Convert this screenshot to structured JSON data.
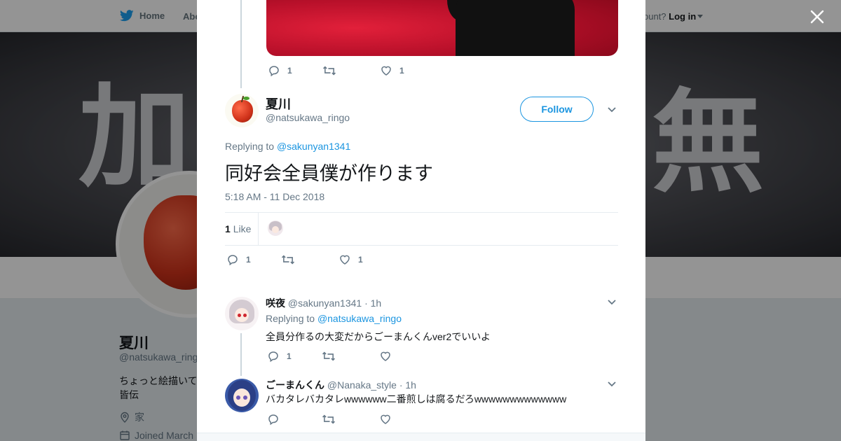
{
  "topbar": {
    "home_label": "Home",
    "about_label": "Abo",
    "account_prompt": "ccount?",
    "login_label": "Log in"
  },
  "banner": {
    "left_text": "加",
    "right_text": "無"
  },
  "profile": {
    "name": "夏川",
    "handle": "@natsukawa_ring",
    "bio_line1": "ちょっと絵描いて",
    "bio_line2": "皆伝",
    "location": "家",
    "joined": "Joined March"
  },
  "previous_tweet": {
    "reply_count": "1",
    "like_count": "1"
  },
  "main_tweet": {
    "name": "夏川",
    "handle": "@natsukawa_ringo",
    "follow_label": "Follow",
    "replying_prefix": "Replying to",
    "replying_to": "@sakunyan1341",
    "text": "同好会全員僕が作ります",
    "timestamp": "5:18 AM - 11 Dec 2018",
    "like_stat_count": "1",
    "like_stat_label": "Like",
    "reply_count": "1",
    "like_count": "1"
  },
  "replies": [
    {
      "name": "咲夜",
      "handle": "@sakunyan1341",
      "time": "· 1h",
      "replying_prefix": "Replying to",
      "replying_to": "@natsukawa_ringo",
      "text": "全員分作るの大変だからごーまんくんver2でいいよ",
      "reply_count": "1"
    },
    {
      "name": "ごーまんくん",
      "handle": "@Nanaka_style",
      "time": "· 1h",
      "text": "バカタレバカタレwwwwww二番煎しは腐るだろwwwwwwwwwwwww"
    }
  ],
  "colors": {
    "accent": "#1b95e0",
    "secondary_text": "#657786",
    "primary_text": "#14171a",
    "thread_line": "#ccd6dd"
  },
  "icons": [
    "twitter-bird-icon",
    "close-icon",
    "reply-icon",
    "retweet-icon",
    "heart-icon",
    "chevron-down-icon",
    "location-icon",
    "calendar-icon"
  ]
}
